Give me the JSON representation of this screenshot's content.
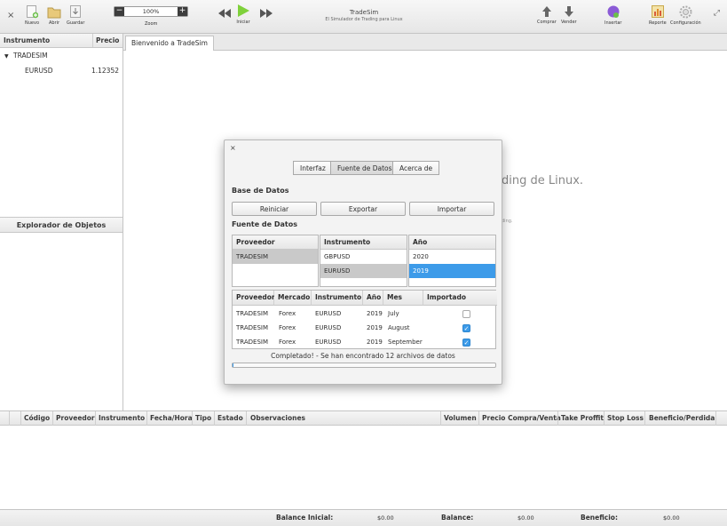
{
  "app": {
    "title": "TradeSim",
    "subtitle": "El Simulador de Trading para Linux"
  },
  "toolbar": {
    "close_glyph": "×",
    "maximize_glyph": "⤢",
    "nuevo": "Nuevo",
    "abrir": "Abrir",
    "guardar": "Guardar",
    "zoom_value": "100%",
    "zoom_label": "Zoom",
    "zoom_minus": "−",
    "zoom_plus": "+",
    "iniciar": "Iniciar",
    "comprar": "Comprar",
    "vender": "Vender",
    "insertar": "Insertar",
    "reporte": "Reporte",
    "configuracion": "Configuración",
    "colors": {
      "play": "#7fd13b",
      "purple": "#8b5bd6"
    }
  },
  "left_panel": {
    "col_instrumento": "Instrumento",
    "col_precio": "Precio",
    "group": "TRADESIM",
    "group_arrow": "▼",
    "item_name": "EURUSD",
    "item_price": "1.12352",
    "object_explorer": "Explorador de Objetos"
  },
  "main": {
    "tab_welcome": "Bienvenido a TradeSim",
    "bg_big": "ding de Linux.",
    "bg_small": "ding."
  },
  "dialog": {
    "close": "×",
    "tabs": [
      "Interfaz",
      "Fuente de Datos",
      "Acerca de"
    ],
    "active_tab": "Fuente de Datos",
    "db_section": "Base de Datos",
    "btn_reiniciar": "Reiniciar",
    "btn_exportar": "Exportar",
    "btn_importar": "Importar",
    "ds_section": "Fuente de Datos",
    "providers": {
      "header": "Proveedor",
      "items": [
        "TRADESIM"
      ]
    },
    "instruments": {
      "header": "Instrumento",
      "items": [
        "GBPUSD",
        "EURUSD"
      ]
    },
    "years": {
      "header": "Año",
      "items": [
        "2020",
        "2019"
      ]
    },
    "table": {
      "headers": [
        "Proveedor",
        "Mercado",
        "Instrumento",
        "Año",
        "Mes",
        "Importado"
      ],
      "rows": [
        {
          "proveedor": "TRADESIM",
          "mercado": "Forex",
          "instrumento": "EURUSD",
          "anio": "2019",
          "mes": "July",
          "importado": false
        },
        {
          "proveedor": "TRADESIM",
          "mercado": "Forex",
          "instrumento": "EURUSD",
          "anio": "2019",
          "mes": "August",
          "importado": true
        },
        {
          "proveedor": "TRADESIM",
          "mercado": "Forex",
          "instrumento": "EURUSD",
          "anio": "2019",
          "mes": "September",
          "importado": true
        }
      ]
    },
    "status": "Completado! - Se han encontrado 12 archivos de datos",
    "check_glyph": "✓",
    "accent": "#3d9be9"
  },
  "orders": {
    "headers": [
      "Código",
      "Proveedor",
      "Instrumento",
      "Fecha/Hora",
      "Tipo",
      "Estado",
      "Observaciones",
      "Volumen",
      "Precio Compra/Venta",
      "Take Proffit",
      "Stop Loss",
      "Beneficio/Perdida"
    ]
  },
  "status_bar": {
    "balance_inicial_label": "Balance Inicial:",
    "balance_inicial_value": "$0.00",
    "balance_label": "Balance:",
    "balance_value": "$0.00",
    "beneficio_label": "Beneficio:",
    "beneficio_value": "$0.00"
  }
}
